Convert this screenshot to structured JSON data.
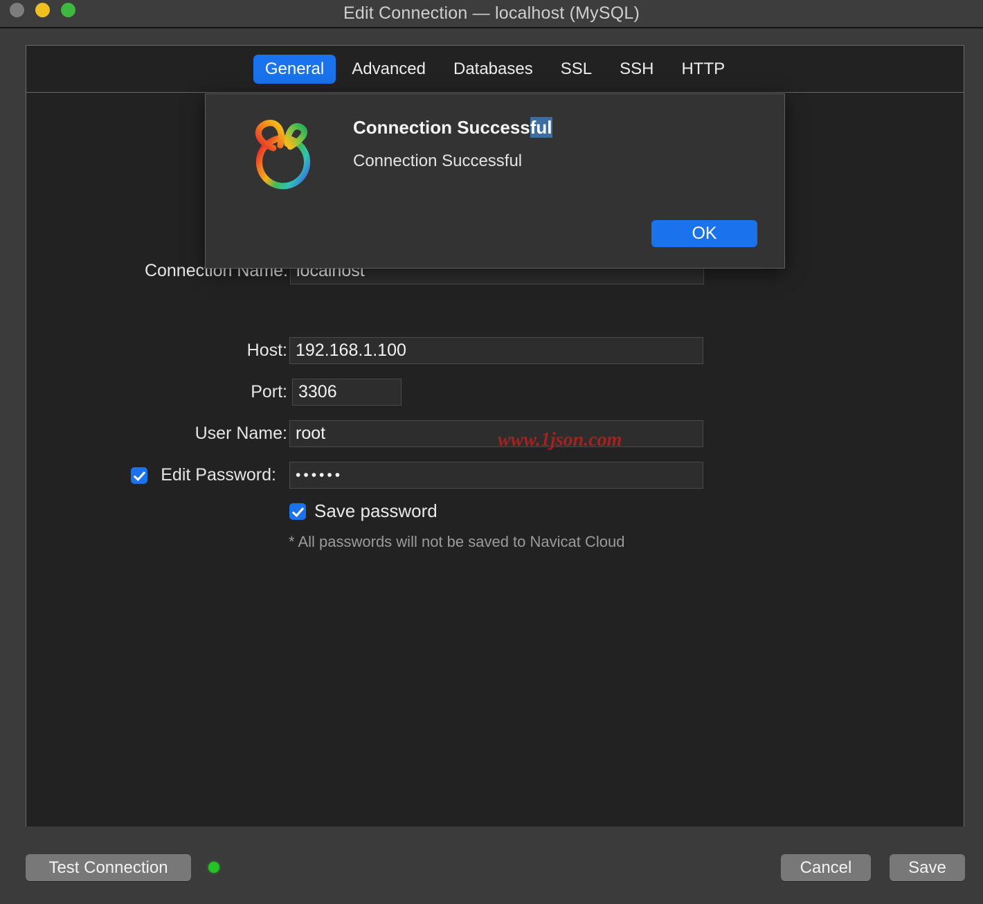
{
  "window": {
    "title": "Edit Connection — localhost (MySQL)",
    "traffic_lights": [
      "close",
      "minimize",
      "zoom"
    ]
  },
  "tabs": [
    {
      "label": "General",
      "active": true
    },
    {
      "label": "Advanced",
      "active": false
    },
    {
      "label": "Databases",
      "active": false
    },
    {
      "label": "SSL",
      "active": false
    },
    {
      "label": "SSH",
      "active": false
    },
    {
      "label": "HTTP",
      "active": false
    }
  ],
  "form": {
    "connection_name": {
      "label": "Connection Name:",
      "value": "localhost"
    },
    "host": {
      "label": "Host:",
      "value": "192.168.1.100"
    },
    "port": {
      "label": "Port:",
      "value": "3306"
    },
    "user_name": {
      "label": "User Name:",
      "value": "root"
    },
    "edit_password": {
      "label": "Edit Password:",
      "checked": true,
      "value": "••••••"
    },
    "save_password": {
      "label": "Save password",
      "checked": true
    },
    "note": "* All passwords will not be saved to Navicat Cloud"
  },
  "watermark": "www.1json.com",
  "footer": {
    "test_connection": "Test Connection",
    "cancel": "Cancel",
    "save": "Save",
    "status_color": "#25c425"
  },
  "dialog": {
    "heading_plain": "Connection Success",
    "heading_selected": "ful",
    "message": "Connection Successful",
    "ok_label": "OK",
    "accent_color": "#1a72ec",
    "selection_color": "#3a6ea5"
  }
}
